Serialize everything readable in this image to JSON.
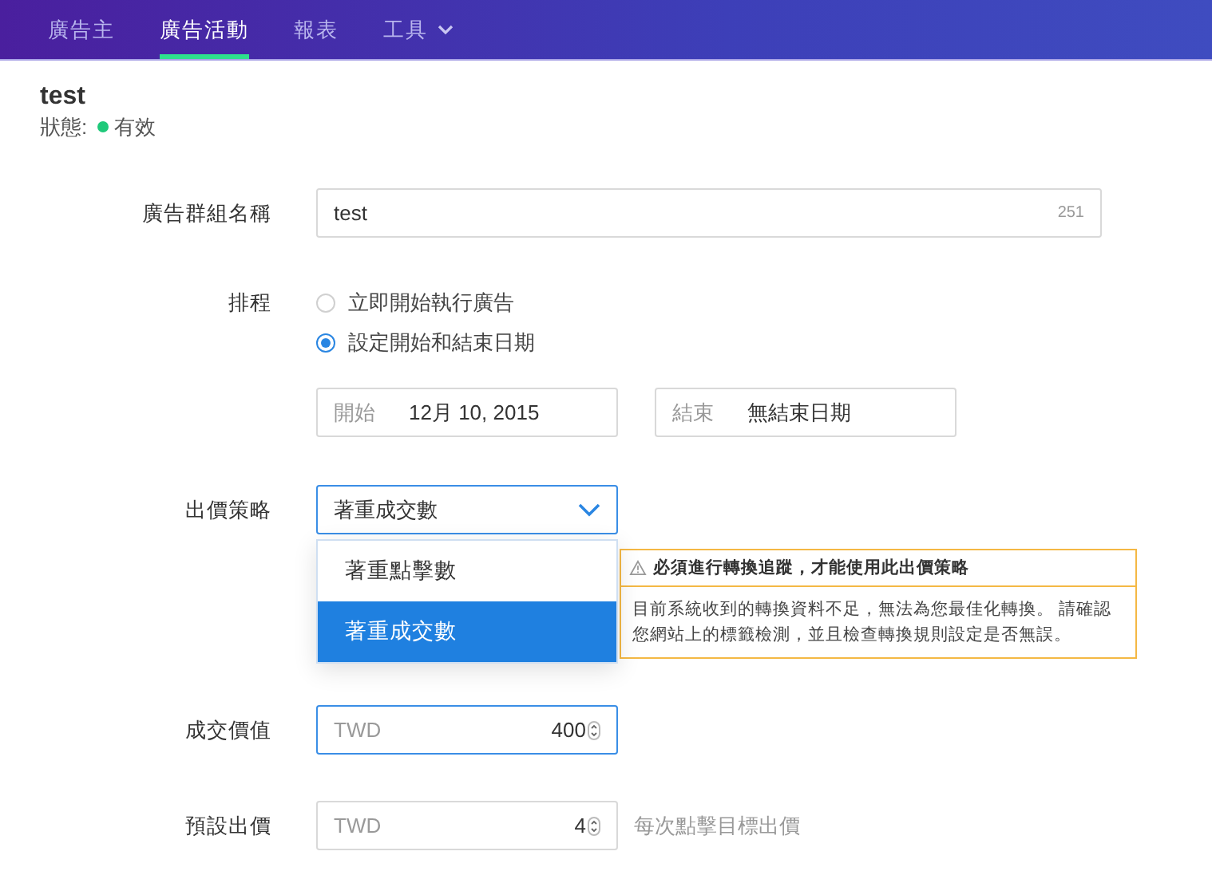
{
  "nav": {
    "tabs": [
      {
        "label": "廣告主",
        "selected": false,
        "has_menu": false
      },
      {
        "label": "廣告活動",
        "selected": true,
        "has_menu": false
      },
      {
        "label": "報表",
        "selected": false,
        "has_menu": false
      },
      {
        "label": "工具",
        "selected": false,
        "has_menu": true
      }
    ]
  },
  "campaign": {
    "name": "test",
    "status_label": "狀態:",
    "status": "有效"
  },
  "form": {
    "ad_group_name": {
      "label": "廣告群組名稱",
      "value": "test",
      "counter": "251"
    },
    "schedule": {
      "label": "排程",
      "options": [
        {
          "label": "立即開始執行廣告",
          "selected": false
        },
        {
          "label": "設定開始和結束日期",
          "selected": true
        }
      ],
      "start": {
        "label": "開始",
        "value": "12月 10, 2015"
      },
      "end": {
        "label": "結束",
        "value": "無結束日期"
      }
    },
    "bid_strategy": {
      "label": "出價策略",
      "value": "著重成交數",
      "expanded": true,
      "options": [
        {
          "label": "著重點擊數",
          "selected": false
        },
        {
          "label": "著重成交數",
          "selected": true
        }
      ],
      "warning": {
        "title": "必須進行轉換追蹤，才能使用此出價策略",
        "body": "目前系統收到的轉換資料不足，無法為您最佳化轉換。 請確認您網站上的標籤檢測，並且檢查轉換規則設定是否無誤。"
      }
    },
    "conversion_value": {
      "label": "成交價值",
      "currency": "TWD",
      "value": "400",
      "focused": true
    },
    "default_bid": {
      "label": "預設出價",
      "currency": "TWD",
      "value": "4",
      "focused": false,
      "hint": "每次點擊目標出價"
    }
  }
}
